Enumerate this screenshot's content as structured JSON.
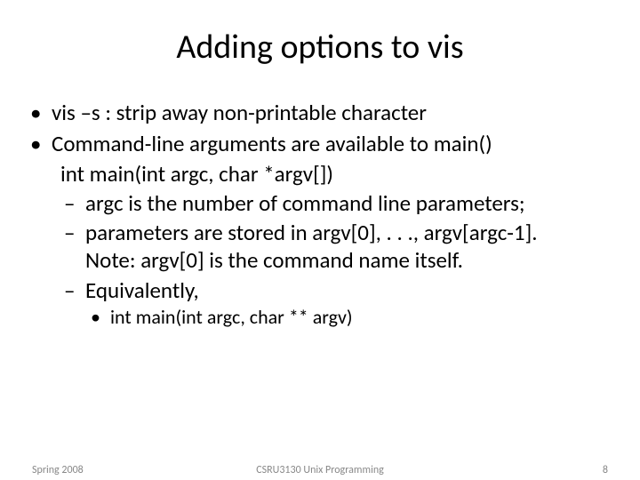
{
  "slide": {
    "title": "Adding options to vis",
    "bullets": {
      "b1": "vis –s : strip away non-printable character",
      "b2": "Command-line arguments are available to main()",
      "code1": "int main(int argc, char *argv[])",
      "sub1": "argc is the number of command line parameters;",
      "sub2a": "parameters are stored in argv[0], . . ., argv[argc-1].",
      "sub2b": "Note: argv[0] is the command name itself.",
      "sub3": "Equivalently,",
      "sub3_inner": "int main(int argc, char ** argv)"
    },
    "footer": {
      "left": "Spring 2008",
      "center": "CSRU3130 Unix Programming",
      "right": "8"
    }
  }
}
